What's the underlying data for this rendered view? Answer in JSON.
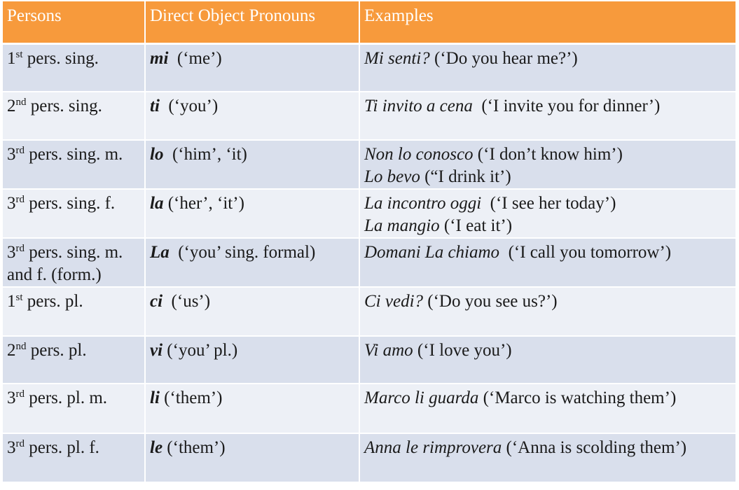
{
  "headers": [
    "Persons",
    "Direct Object Pronouns",
    "Examples"
  ],
  "rows": [
    {
      "person": {
        "num": "1",
        "sup": "st",
        "rest": " pers. sing.",
        "cont": ""
      },
      "pronoun": "mi",
      "gloss": "  (‘me’)",
      "examples": [
        {
          "it": "Mi senti?",
          "tr": " (‘Do you hear me?’)"
        },
        {
          "it": "",
          "tr": ""
        }
      ]
    },
    {
      "person": {
        "num": "2",
        "sup": "nd",
        "rest": " pers. sing.",
        "cont": ""
      },
      "pronoun": "ti",
      "gloss": "  (‘you’)",
      "examples": [
        {
          "it": "Ti invito a cena",
          "tr": "  (‘I invite you for dinner’)"
        },
        {
          "it": "",
          "tr": ""
        }
      ]
    },
    {
      "person": {
        "num": "3",
        "sup": "rd",
        "rest": " pers. sing. m.",
        "cont": ""
      },
      "pronoun": "lo",
      "gloss": "  (‘him’, ‘it)",
      "examples": [
        {
          "it": "Non lo conosco",
          "tr": " (‘I don’t know him’)"
        },
        {
          "it": "Lo bevo",
          "tr": " (“I drink it’)"
        }
      ]
    },
    {
      "person": {
        "num": "3",
        "sup": "rd",
        "rest": " pers. sing. f.",
        "cont": ""
      },
      "pronoun": "la",
      "gloss": " (‘her’, ‘it’)",
      "examples": [
        {
          "it": "La incontro oggi",
          "tr": "  (‘I see her today’)"
        },
        {
          "it": "La mangio",
          "tr": " (‘I eat it’)"
        }
      ]
    },
    {
      "person": {
        "num": "3",
        "sup": "rd",
        "rest": " pers. sing. m.",
        "cont": "and f. (form.)"
      },
      "pronoun": "La",
      "gloss": "  (‘you’ sing. formal)",
      "examples": [
        {
          "it": "Domani La chiamo",
          "tr": "  (‘I call you tomorrow’)"
        },
        {
          "it": "",
          "tr": ""
        }
      ]
    },
    {
      "person": {
        "num": "1",
        "sup": "st",
        "rest": " pers. pl.",
        "cont": ""
      },
      "pronoun": "ci",
      "gloss": "  (‘us’)",
      "examples": [
        {
          "it": "Ci vedi?",
          "tr": " (‘Do you see us?’)"
        },
        {
          "it": "",
          "tr": ""
        }
      ]
    },
    {
      "person": {
        "num": "2",
        "sup": "nd",
        "rest": " pers. pl.",
        "cont": ""
      },
      "pronoun": "vi",
      "gloss": " (‘you’ pl.)",
      "examples": [
        {
          "it": "Vi amo",
          "tr": " (‘I love you’)"
        },
        {
          "it": "",
          "tr": ""
        }
      ]
    },
    {
      "person": {
        "num": "3",
        "sup": "rd",
        "rest": " pers. pl. m.",
        "cont": ""
      },
      "pronoun": "li",
      "gloss": " (‘them’)",
      "examples": [
        {
          "it": "Marco li guarda",
          "tr": " (‘Marco is watching them’)"
        },
        {
          "it": "",
          "tr": ""
        }
      ]
    },
    {
      "person": {
        "num": "3",
        "sup": "rd",
        "rest": " pers. pl. f.",
        "cont": ""
      },
      "pronoun": "le",
      "gloss": " (‘them’)",
      "examples": [
        {
          "it": "Anna le rimprovera",
          "tr": " (‘Anna is scolding them’)"
        },
        {
          "it": "",
          "tr": ""
        }
      ]
    }
  ]
}
